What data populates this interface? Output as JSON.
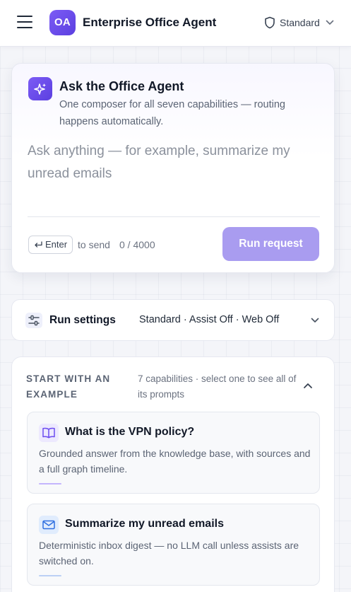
{
  "header": {
    "logo_text": "OA",
    "app_title": "Enterprise Office Agent",
    "mode_label": "Standard",
    "icons": {
      "menu": "hamburger-menu-icon",
      "mode": "shield-icon",
      "dropdown": "chevron-down-icon"
    }
  },
  "composer": {
    "title": "Ask the Office Agent",
    "subtitle": "One composer for all seven capabilities — routing happens automatically.",
    "placeholder": "Ask anything — for example, summarize my unread emails",
    "value": "",
    "enter_key_label": "Enter",
    "send_hint": "to send",
    "counter": "0 / 4000",
    "run_button_label": "Run request",
    "icon": "sparkles-icon"
  },
  "settings": {
    "title": "Run settings",
    "summary": "Standard · Assist Off · Web Off",
    "icon": "sliders-icon"
  },
  "examples": {
    "heading": "START WITH AN EXAMPLE",
    "meta": "7 capabilities · select one to see all of its prompts",
    "items": [
      {
        "title": "What is the VPN policy?",
        "description": "Grounded answer from the knowledge base, with sources and a full graph timeline.",
        "icon": "book-open-icon",
        "accent_color": "#c4b5fd"
      },
      {
        "title": "Summarize my unread emails",
        "description": "Deterministic inbox digest — no LLM call unless assists are switched on.",
        "icon": "mail-icon",
        "accent_color": "#bcd0f5"
      }
    ]
  },
  "colors": {
    "brand": "#6d4df0",
    "run_button": "#a99cf0",
    "page_background": "#f4f5f9"
  }
}
